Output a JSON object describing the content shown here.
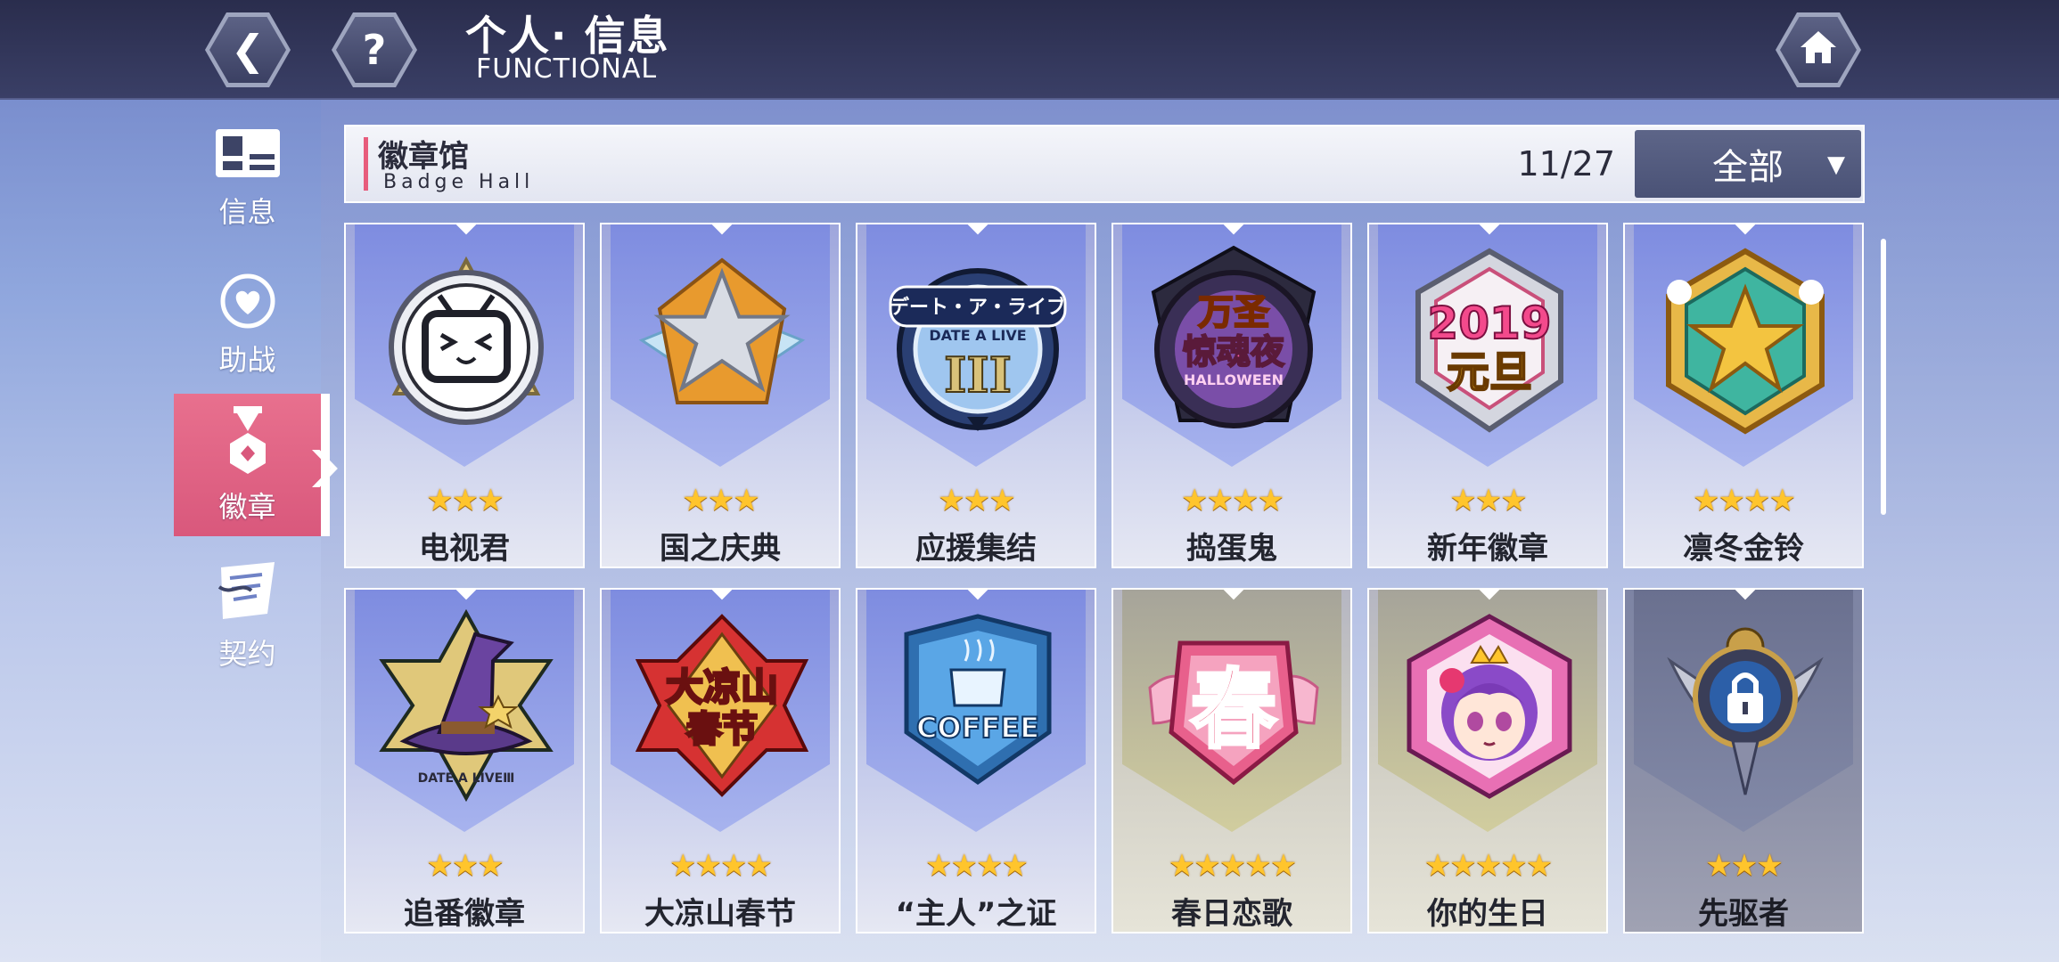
{
  "header": {
    "title_cn": "个人· 信息",
    "title_en": "FUNCTIONAL",
    "back_icon": "back-arrow-icon",
    "help_icon": "question-icon",
    "home_icon": "home-icon"
  },
  "sidebar": {
    "items": [
      {
        "label": "信息",
        "icon": "profile-card-icon"
      },
      {
        "label": "助战",
        "icon": "heart-icon"
      },
      {
        "label": "徽章",
        "icon": "medal-icon",
        "active": true
      },
      {
        "label": "契约",
        "icon": "contract-scroll-icon"
      }
    ]
  },
  "hall": {
    "title": "徽章馆",
    "subtitle": "Badge Hall",
    "count": "11/27",
    "filter": "全部"
  },
  "badges": [
    {
      "name": "电视君",
      "stars": "★★★",
      "art": "tv-mascot-badge"
    },
    {
      "name": "国之庆典",
      "stars": "★★★",
      "art": "silver-star-badge"
    },
    {
      "name": "应援集结",
      "stars": "★★★",
      "art": "date-a-live-iii-badge",
      "art_text": "デート・ア・ライブ",
      "art_text2": "DATE A LIVE",
      "art_text3": "III"
    },
    {
      "name": "捣蛋鬼",
      "stars": "★★★★",
      "art": "halloween-badge",
      "art_text": "万圣",
      "art_text2": "惊魂夜",
      "art_text3": "HALLOWEEN"
    },
    {
      "name": "新年徽章",
      "stars": "★★★",
      "art": "new-year-2019-badge",
      "art_text": "2019",
      "art_text2": "元旦"
    },
    {
      "name": "凛冬金铃",
      "stars": "★★★★",
      "art": "gold-star-badge"
    },
    {
      "name": "追番徽章",
      "stars": "★★★",
      "art": "witch-hat-badge",
      "art_text": "DATE A LIVEⅢ"
    },
    {
      "name": "大凉山春节",
      "stars": "★★★★",
      "art": "daliangshan-badge",
      "art_text": "大凉山",
      "art_text2": "春节"
    },
    {
      "name": "“主人”之证",
      "stars": "★★★★",
      "art": "coffee-badge",
      "art_text": "COFFEE"
    },
    {
      "name": "春日恋歌",
      "stars": "★★★★★",
      "art": "spring-badge",
      "art_text": "春"
    },
    {
      "name": "你的生日",
      "stars": "★★★★★",
      "art": "birthday-girl-badge"
    },
    {
      "name": "先驱者",
      "stars": "★★★",
      "art": "locked-pioneer-badge",
      "locked": true
    }
  ]
}
